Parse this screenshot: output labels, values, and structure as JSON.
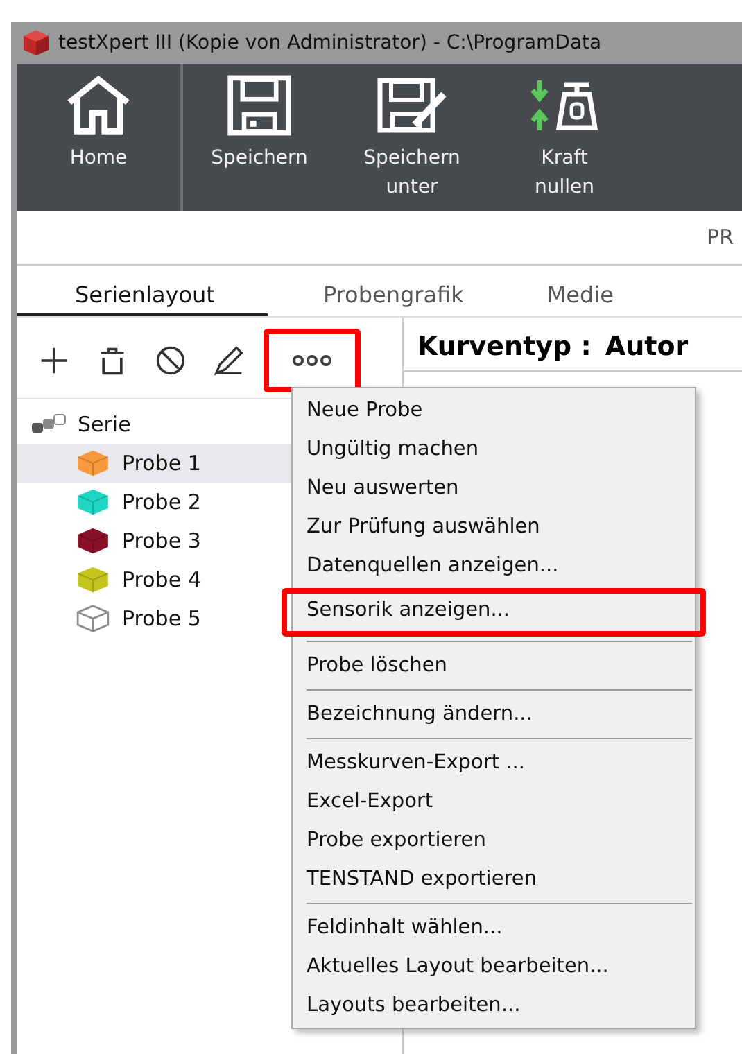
{
  "window": {
    "title": "testXpert III (Kopie von Administrator) - C:\\ProgramData"
  },
  "toolbar": [
    {
      "label": "Home",
      "kind": "home"
    },
    {
      "label": "Speichern",
      "kind": "save"
    },
    {
      "label": "Speichern\nunter",
      "kind": "save-as"
    },
    {
      "label": "Kraft\nnullen",
      "kind": "zero-force"
    }
  ],
  "header_band": {
    "text": "PR"
  },
  "tabs": [
    {
      "label": "Serienlayout",
      "selected": true
    },
    {
      "label": "Probengrafik",
      "selected": false
    },
    {
      "label": "Medie",
      "selected": false
    }
  ],
  "tree_toolbar": [
    {
      "kind": "add",
      "highlighted": false
    },
    {
      "kind": "delete",
      "highlighted": false
    },
    {
      "kind": "invalid",
      "highlighted": false
    },
    {
      "kind": "edit",
      "highlighted": false
    },
    {
      "kind": "more",
      "highlighted": true
    }
  ],
  "tree": {
    "label": "Serie",
    "children": [
      {
        "label": "Probe 1",
        "kind": "solid",
        "color": "#f89a3c",
        "selected": true
      },
      {
        "label": "Probe 2",
        "kind": "solid",
        "color": "#1fd6c4",
        "selected": false
      },
      {
        "label": "Probe 3",
        "kind": "solid",
        "color": "#8a1028",
        "selected": false
      },
      {
        "label": "Probe 4",
        "kind": "solid",
        "color": "#c4c41e",
        "selected": false
      },
      {
        "label": "Probe 5",
        "kind": "outline",
        "color": "#8c8c8c",
        "selected": false
      }
    ]
  },
  "curve_type": {
    "label": "Kurventyp :",
    "value": "Autor"
  },
  "context_menu": [
    [
      {
        "label": "Neue Probe",
        "highlighted": false
      },
      {
        "label": "Ungültig machen",
        "highlighted": false
      },
      {
        "label": "Neu auswerten",
        "highlighted": false
      },
      {
        "label": "Zur Prüfung auswählen",
        "highlighted": false
      },
      {
        "label": "Datenquellen anzeigen...",
        "highlighted": false
      },
      {
        "label": "Sensorik anzeigen...",
        "highlighted": true
      }
    ],
    [
      {
        "label": "Probe löschen",
        "highlighted": false
      }
    ],
    [
      {
        "label": "Bezeichnung ändern...",
        "highlighted": false
      }
    ],
    [
      {
        "label": "Messkurven-Export ...",
        "highlighted": false
      },
      {
        "label": "Excel-Export",
        "highlighted": false
      },
      {
        "label": "Probe exportieren",
        "highlighted": false
      },
      {
        "label": "TENSTAND exportieren",
        "highlighted": false
      }
    ],
    [
      {
        "label": "Feldinhalt wählen...",
        "highlighted": false
      },
      {
        "label": "Aktuelles Layout bearbeiten...",
        "highlighted": false
      },
      {
        "label": "Layouts bearbeiten...",
        "highlighted": false
      }
    ]
  ]
}
